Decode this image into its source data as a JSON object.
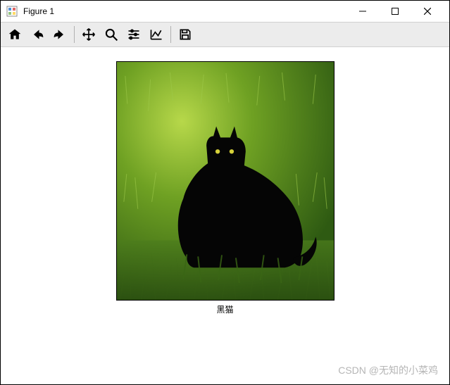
{
  "window": {
    "title": "Figure 1"
  },
  "toolbar": {
    "home": "home-icon",
    "back": "arrow-left-icon",
    "forward": "arrow-right-icon",
    "pan": "move-icon",
    "zoom": "magnify-icon",
    "subplots": "sliders-icon",
    "axes": "chart-line-icon",
    "save": "save-icon"
  },
  "figure": {
    "caption": "黑猫",
    "image_alt": "black cat in green grass"
  },
  "watermark": "CSDN @无知的小菜鸡"
}
